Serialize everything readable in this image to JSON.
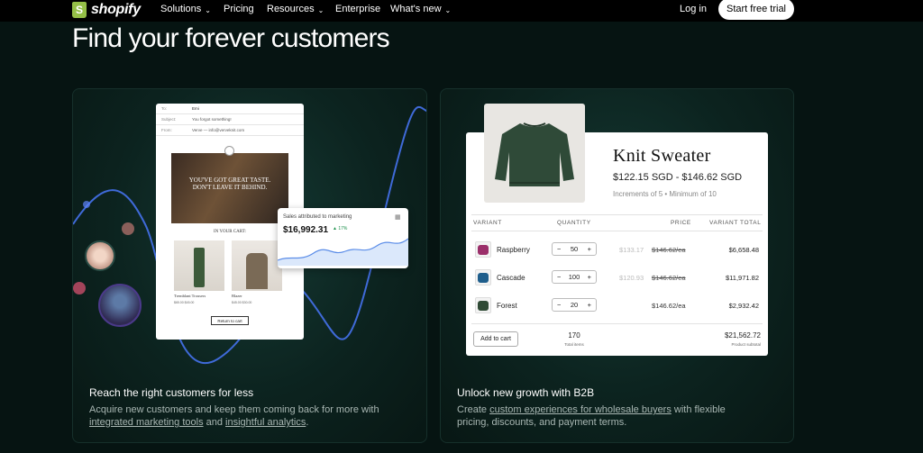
{
  "nav": {
    "logo_text": "shopify",
    "items": [
      {
        "label": "Solutions",
        "has_dropdown": true
      },
      {
        "label": "Pricing",
        "has_dropdown": false
      },
      {
        "label": "Resources",
        "has_dropdown": true
      },
      {
        "label": "Enterprise",
        "has_dropdown": false
      },
      {
        "label": "What's new",
        "has_dropdown": true
      }
    ],
    "login": "Log in",
    "cta": "Start free trial",
    "dropdown_icon": "chevron-down-icon"
  },
  "headline": "Find your forever customers",
  "colors": {
    "background": "#061412",
    "accent_green": "#95bf47",
    "wave_blue": "#3f6ad8"
  },
  "left_card": {
    "title": "Reach the right customers for less",
    "desc_before": "Acquire new customers and keep them coming back for more with ",
    "link1": "integrated marketing tools",
    "desc_mid": " and ",
    "link2": "insightful analytics",
    "desc_after": ".",
    "email": {
      "to_label": "To:",
      "to_value": "Emi",
      "subject_label": "Subject:",
      "subject_value": "You forgot something!",
      "from_label": "From:",
      "from_value": "Verve — info@verveknit.com",
      "hero_text": "YOU'VE GOT GREAT TASTE. DON'T LEAVE IT BEHIND.",
      "cart_heading": "IN YOUR CART:",
      "products": [
        {
          "name": "Tremblant Trousers",
          "price": "$65.00  $45.00"
        },
        {
          "name": "Blazer",
          "price": "$45.00  $30.00"
        }
      ],
      "return_button": "Return to cart"
    },
    "sales_widget": {
      "label": "Sales attributed to marketing",
      "value": "$16,992.31",
      "change": "▲ 17%",
      "icon": "calendar-icon"
    }
  },
  "right_card": {
    "title": "Unlock new growth with B2B",
    "desc_before": "Create ",
    "link1": "custom experiences for wholesale buyers",
    "desc_after": " with flexible pricing, discounts, and payment terms.",
    "product": {
      "name": "Knit Sweater",
      "price_range": "$122.15 SGD - $146.62 SGD",
      "increments": "Increments of 5 • Minimum of 10",
      "headers": [
        "VARIANT",
        "QUANTITY",
        "PRICE",
        "VARIANT TOTAL"
      ],
      "rows": [
        {
          "variant": "Raspberry",
          "qty": "50",
          "old_price": "$133.17",
          "price": "$146.62/ea",
          "price_struck": true,
          "total": "$6,658.48",
          "color": "#9b2f6a"
        },
        {
          "variant": "Cascade",
          "qty": "100",
          "old_price": "$120.93",
          "price": "$146.62/ea",
          "price_struck": true,
          "total": "$11,971.82",
          "color": "#1f5e8c"
        },
        {
          "variant": "Forest",
          "qty": "20",
          "old_price": "",
          "price": "$146.62/ea",
          "price_struck": false,
          "total": "$2,932.42",
          "color": "#2f4a35"
        }
      ],
      "add_button": "Add to cart",
      "total_items": "170",
      "total_items_label": "Total items",
      "subtotal": "$21,562.72",
      "subtotal_label": "Product subtotal"
    }
  }
}
